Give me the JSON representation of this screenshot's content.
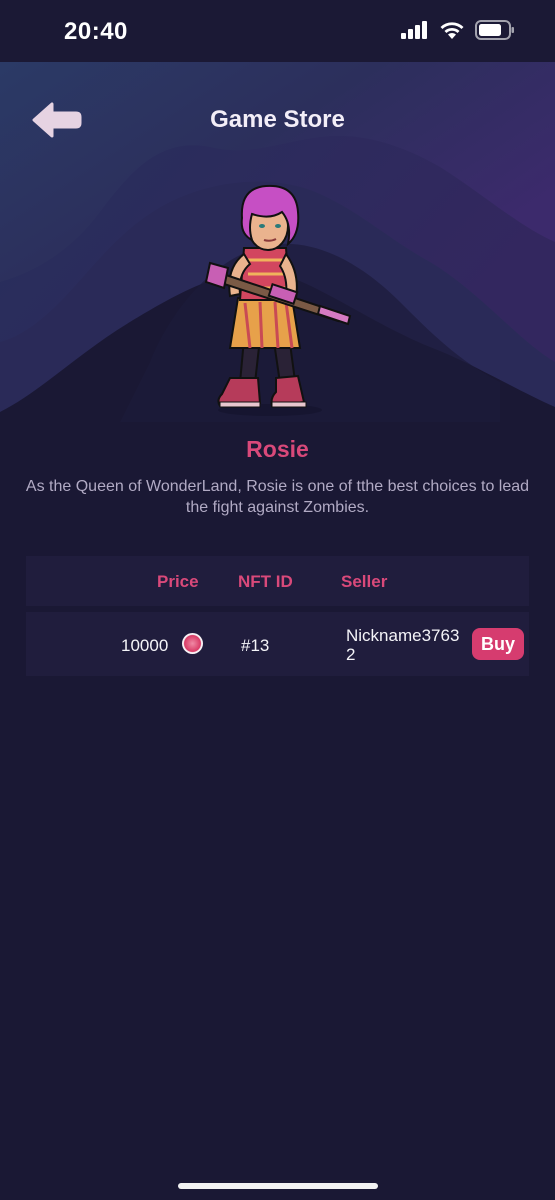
{
  "status_bar": {
    "time": "20:40"
  },
  "header": {
    "title": "Game Store"
  },
  "character": {
    "name": "Rosie",
    "description": "As the Queen of WonderLand, Rosie is one of tthe best choices to lead the fight against Zombies."
  },
  "table": {
    "columns": {
      "price": "Price",
      "nft_id": "NFT ID",
      "seller": "Seller"
    },
    "rows": [
      {
        "price": "10000",
        "nft_id": "#13",
        "seller": "Nickname37632",
        "action": "Buy"
      }
    ]
  },
  "colors": {
    "accent": "#d63c6f",
    "background": "#1a1834",
    "row": "#201d3d"
  }
}
